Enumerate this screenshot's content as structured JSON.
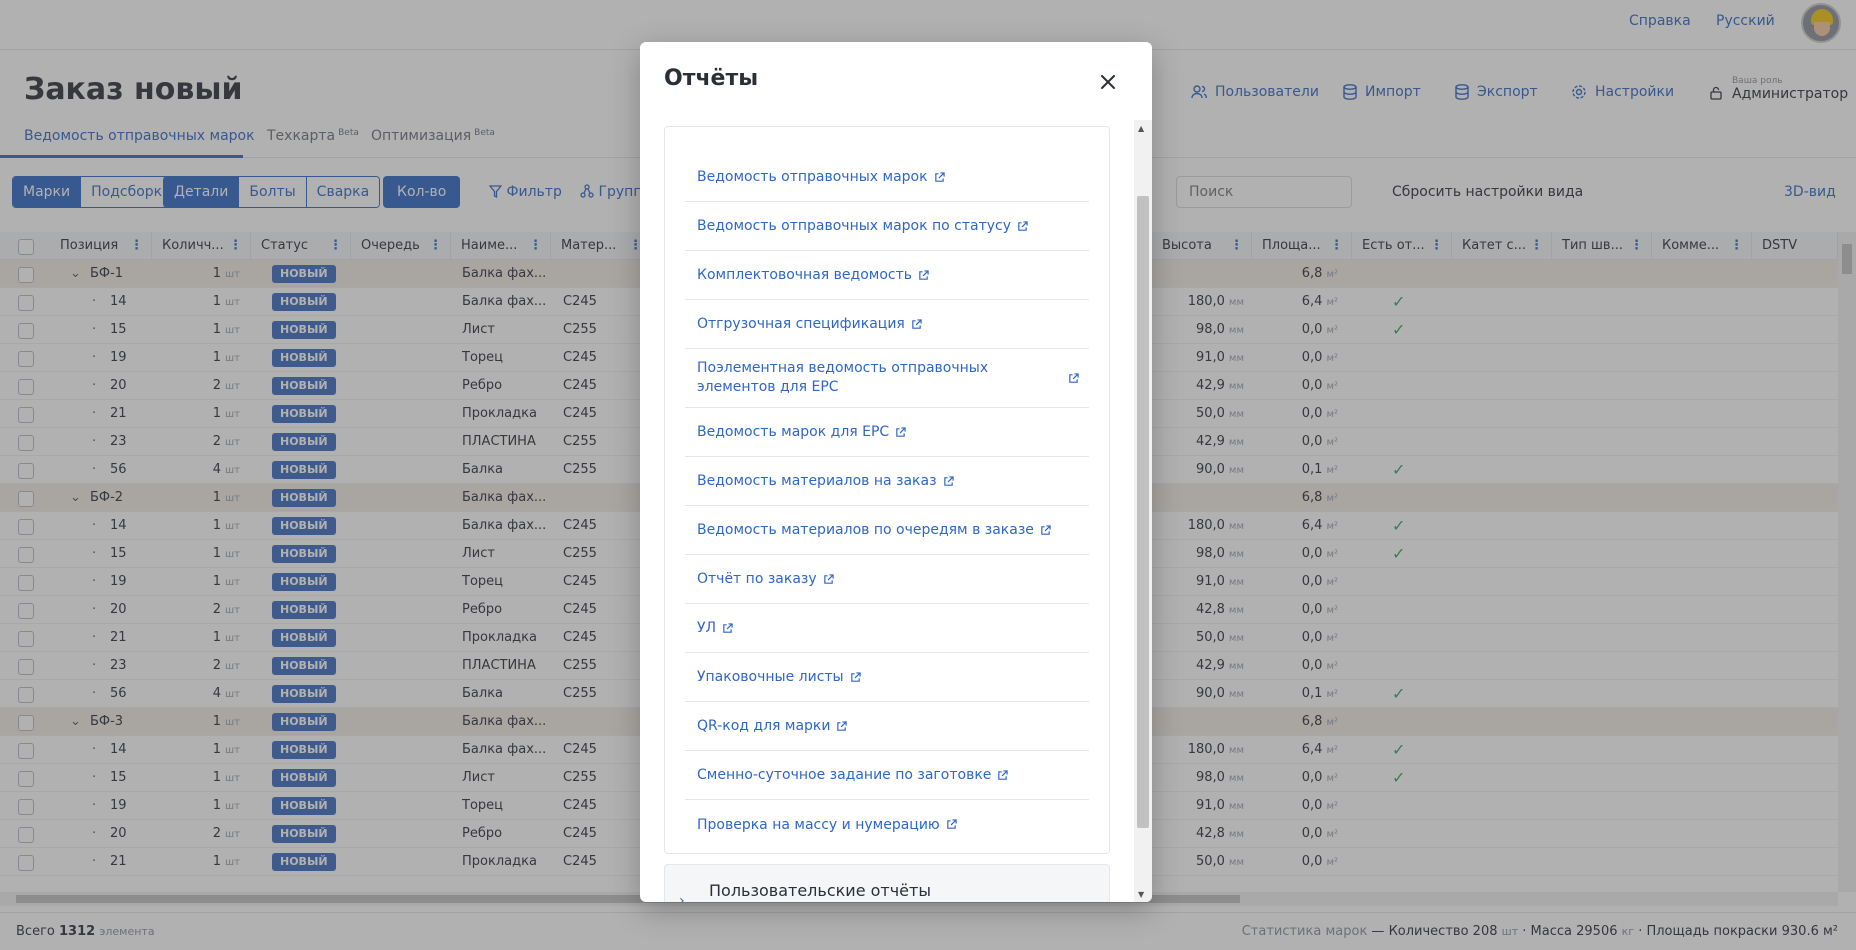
{
  "topbar": {
    "help": "Справка",
    "language": "Русский"
  },
  "page": {
    "title": "Заказ новый"
  },
  "tabs": [
    {
      "label": "Ведомость отправочных марок",
      "beta": ""
    },
    {
      "label": "Техкарта",
      "beta": "Beta"
    },
    {
      "label": "Оптимизация",
      "beta": "Beta"
    }
  ],
  "header_actions": {
    "users": "Пользователи",
    "import": "Импорт",
    "export": "Экспорт",
    "settings": "Настройки",
    "role_label": "Ваша роль",
    "role": "Администратор"
  },
  "toolbar": {
    "segments1": [
      "Марки",
      "Подсборки",
      "Детали",
      "Болты",
      "Сварка"
    ],
    "qty": "Кол-во",
    "filter": "Фильтр",
    "group": "Группа",
    "search_placeholder": "Поиск",
    "reset": "Сбросить настройки вида",
    "view3d": "3D-вид"
  },
  "table": {
    "headers_left": [
      "Позиция",
      "Количч...",
      "Статус",
      "Очередь",
      "Наиме...",
      "Матер..."
    ],
    "headers_right": [
      "Высота",
      "Площа...",
      "Есть от...",
      "Катет с...",
      "Тип шв...",
      "Комме...",
      "DSTV"
    ],
    "qty_unit": "шт",
    "height_unit": "мм",
    "area_unit": "м²",
    "status": "НОВЫЙ",
    "rows": [
      {
        "group": true,
        "pos": "БФ-1",
        "qty": "1",
        "name": "Балка фах...",
        "mat": "",
        "h": "",
        "area": "6,8",
        "ok": false
      },
      {
        "group": false,
        "pos": "14",
        "qty": "1",
        "name": "Балка фах...",
        "mat": "C245",
        "h": "180,0",
        "area": "6,4",
        "ok": true
      },
      {
        "group": false,
        "pos": "15",
        "qty": "1",
        "name": "Лист",
        "mat": "C255",
        "h": "98,0",
        "area": "0,0",
        "ok": true
      },
      {
        "group": false,
        "pos": "19",
        "qty": "1",
        "name": "Торец",
        "mat": "C245",
        "h": "91,0",
        "area": "0,0",
        "ok": false
      },
      {
        "group": false,
        "pos": "20",
        "qty": "2",
        "name": "Ребро",
        "mat": "C245",
        "h": "42,9",
        "area": "0,0",
        "ok": false
      },
      {
        "group": false,
        "pos": "21",
        "qty": "1",
        "name": "Прокладка",
        "mat": "C245",
        "h": "50,0",
        "area": "0,0",
        "ok": false
      },
      {
        "group": false,
        "pos": "23",
        "qty": "2",
        "name": "ПЛАСТИНА",
        "mat": "C255",
        "h": "42,9",
        "area": "0,0",
        "ok": false
      },
      {
        "group": false,
        "pos": "56",
        "qty": "4",
        "name": "Балка",
        "mat": "C255",
        "h": "90,0",
        "area": "0,1",
        "ok": true
      },
      {
        "group": true,
        "pos": "БФ-2",
        "qty": "1",
        "name": "Балка фах...",
        "mat": "",
        "h": "",
        "area": "6,8",
        "ok": false
      },
      {
        "group": false,
        "pos": "14",
        "qty": "1",
        "name": "Балка фах...",
        "mat": "C245",
        "h": "180,0",
        "area": "6,4",
        "ok": true
      },
      {
        "group": false,
        "pos": "15",
        "qty": "1",
        "name": "Лист",
        "mat": "C255",
        "h": "98,0",
        "area": "0,0",
        "ok": true
      },
      {
        "group": false,
        "pos": "19",
        "qty": "1",
        "name": "Торец",
        "mat": "C245",
        "h": "91,0",
        "area": "0,0",
        "ok": false
      },
      {
        "group": false,
        "pos": "20",
        "qty": "2",
        "name": "Ребро",
        "mat": "C245",
        "h": "42,8",
        "area": "0,0",
        "ok": false
      },
      {
        "group": false,
        "pos": "21",
        "qty": "1",
        "name": "Прокладка",
        "mat": "C245",
        "h": "50,0",
        "area": "0,0",
        "ok": false
      },
      {
        "group": false,
        "pos": "23",
        "qty": "2",
        "name": "ПЛАСТИНА",
        "mat": "C255",
        "h": "42,9",
        "area": "0,0",
        "ok": false
      },
      {
        "group": false,
        "pos": "56",
        "qty": "4",
        "name": "Балка",
        "mat": "C255",
        "h": "90,0",
        "area": "0,1",
        "ok": true
      },
      {
        "group": true,
        "pos": "БФ-3",
        "qty": "1",
        "name": "Балка фах...",
        "mat": "",
        "h": "",
        "area": "6,8",
        "ok": false
      },
      {
        "group": false,
        "pos": "14",
        "qty": "1",
        "name": "Балка фах...",
        "mat": "C245",
        "h": "180,0",
        "area": "6,4",
        "ok": true
      },
      {
        "group": false,
        "pos": "15",
        "qty": "1",
        "name": "Лист",
        "mat": "C255",
        "h": "98,0",
        "area": "0,0",
        "ok": true
      },
      {
        "group": false,
        "pos": "19",
        "qty": "1",
        "name": "Торец",
        "mat": "C245",
        "h": "91,0",
        "area": "0,0",
        "ok": false
      },
      {
        "group": false,
        "pos": "20",
        "qty": "2",
        "name": "Ребро",
        "mat": "C245",
        "h": "42,8",
        "area": "0,0",
        "ok": false
      },
      {
        "group": false,
        "pos": "21",
        "qty": "1",
        "name": "Прокладка",
        "mat": "C245",
        "h": "50,0",
        "area": "0,0",
        "ok": false
      }
    ]
  },
  "footer": {
    "total_label": "Всего",
    "total_value": "1312",
    "total_unit": "элемента",
    "stats_label": "Статистика марок",
    "qty_label": "Количество",
    "qty_value": "208",
    "qty_unit": "шт",
    "mass_label": "Масса",
    "mass_value": "29506",
    "mass_unit": "кг",
    "paint_label": "Площадь покраски",
    "paint_value": "930.6 м²"
  },
  "modal": {
    "title": "Отчёты",
    "reports": [
      "Ведомость отправочных марок",
      "Ведомость отправочных марок по статусу",
      "Комплектовочная ведомость",
      "Отгрузочная спецификация",
      "Поэлементная ведомость отправочных элементов для EPC",
      "Ведомость марок для EPC",
      "Ведомость материалов на заказ",
      "Ведомость материалов по очередям в заказе",
      "Отчёт по заказу",
      "УЛ",
      "Упаковочные листы",
      "QR-код для марки",
      "Сменно-суточное задание по заготовке",
      "Проверка на массу и нумерацию"
    ],
    "section_user": "Пользовательские отчёты"
  }
}
